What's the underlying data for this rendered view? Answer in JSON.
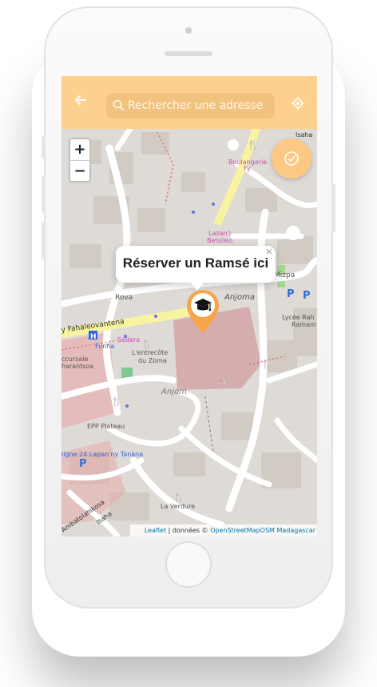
{
  "header": {
    "search_placeholder": "Rechercher une adresse",
    "accent_color": "#fed08e"
  },
  "map": {
    "zoom_in_label": "+",
    "zoom_out_label": "−",
    "labels": {
      "boulangerie": "Boulangerie",
      "fy": "Fy",
      "lazani": "Lazan'i",
      "betsileo": "Betsileo",
      "mizpa": "Mizpa",
      "rova": "Rova",
      "anjoma_road": "Anjoma",
      "fahaleovantena": "y Fahaleovantena",
      "funfia": "Funfia",
      "sedera": "Sedera",
      "lentrecote": "L'entrecôte",
      "du_zoma": "du Zoma",
      "anjoma_area": "Anjom",
      "lycee": "Lycée Rah",
      "ramam": "Ramam",
      "succursale": "ccursale",
      "antsoa": "harantsoa",
      "epp_plateau": "EPP Plateau",
      "ligne24": "ligne 24 Lapan'ny Tanàna",
      "ambatolahikosa": "Ambatolahikosa",
      "isaha_bottom": "Isaha",
      "isaha_top": "Isaha",
      "la_verdure": "La Verdure"
    },
    "attribution": {
      "leaflet": "Leaflet",
      "donnees": " | données © ",
      "osm": "OpenStreetMap",
      "osm_mg": "OSM Madagascar"
    }
  },
  "popup": {
    "text": "Réserver un Ramsé ici",
    "close": "×"
  },
  "marker": {
    "icon": "graduation-cap-icon",
    "color": "#f7a54a"
  },
  "fab": {
    "icon": "check-circle-icon",
    "color": "#fcc985"
  }
}
